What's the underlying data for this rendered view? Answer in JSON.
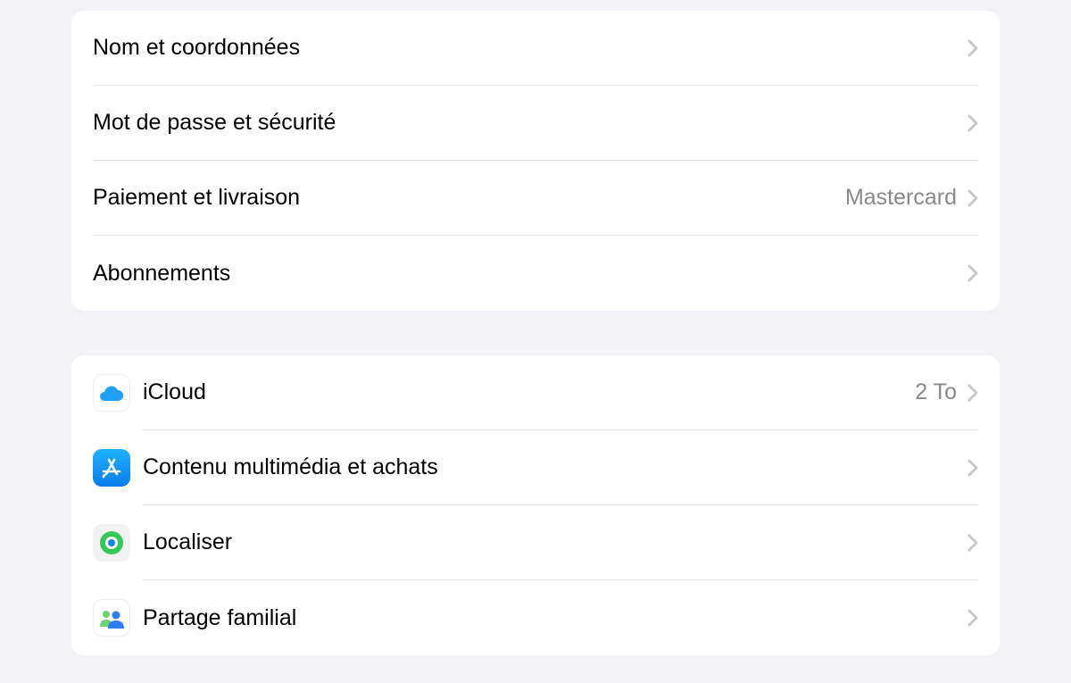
{
  "group1": {
    "items": [
      {
        "label": "Nom et coordonnées",
        "detail": ""
      },
      {
        "label": "Mot de passe et sécurité",
        "detail": ""
      },
      {
        "label": "Paiement et livraison",
        "detail": "Mastercard"
      },
      {
        "label": "Abonnements",
        "detail": ""
      }
    ]
  },
  "group2": {
    "items": [
      {
        "label": "iCloud",
        "detail": "2 To"
      },
      {
        "label": "Contenu multimédia et achats",
        "detail": ""
      },
      {
        "label": "Localiser",
        "detail": ""
      },
      {
        "label": "Partage familial",
        "detail": ""
      }
    ]
  }
}
